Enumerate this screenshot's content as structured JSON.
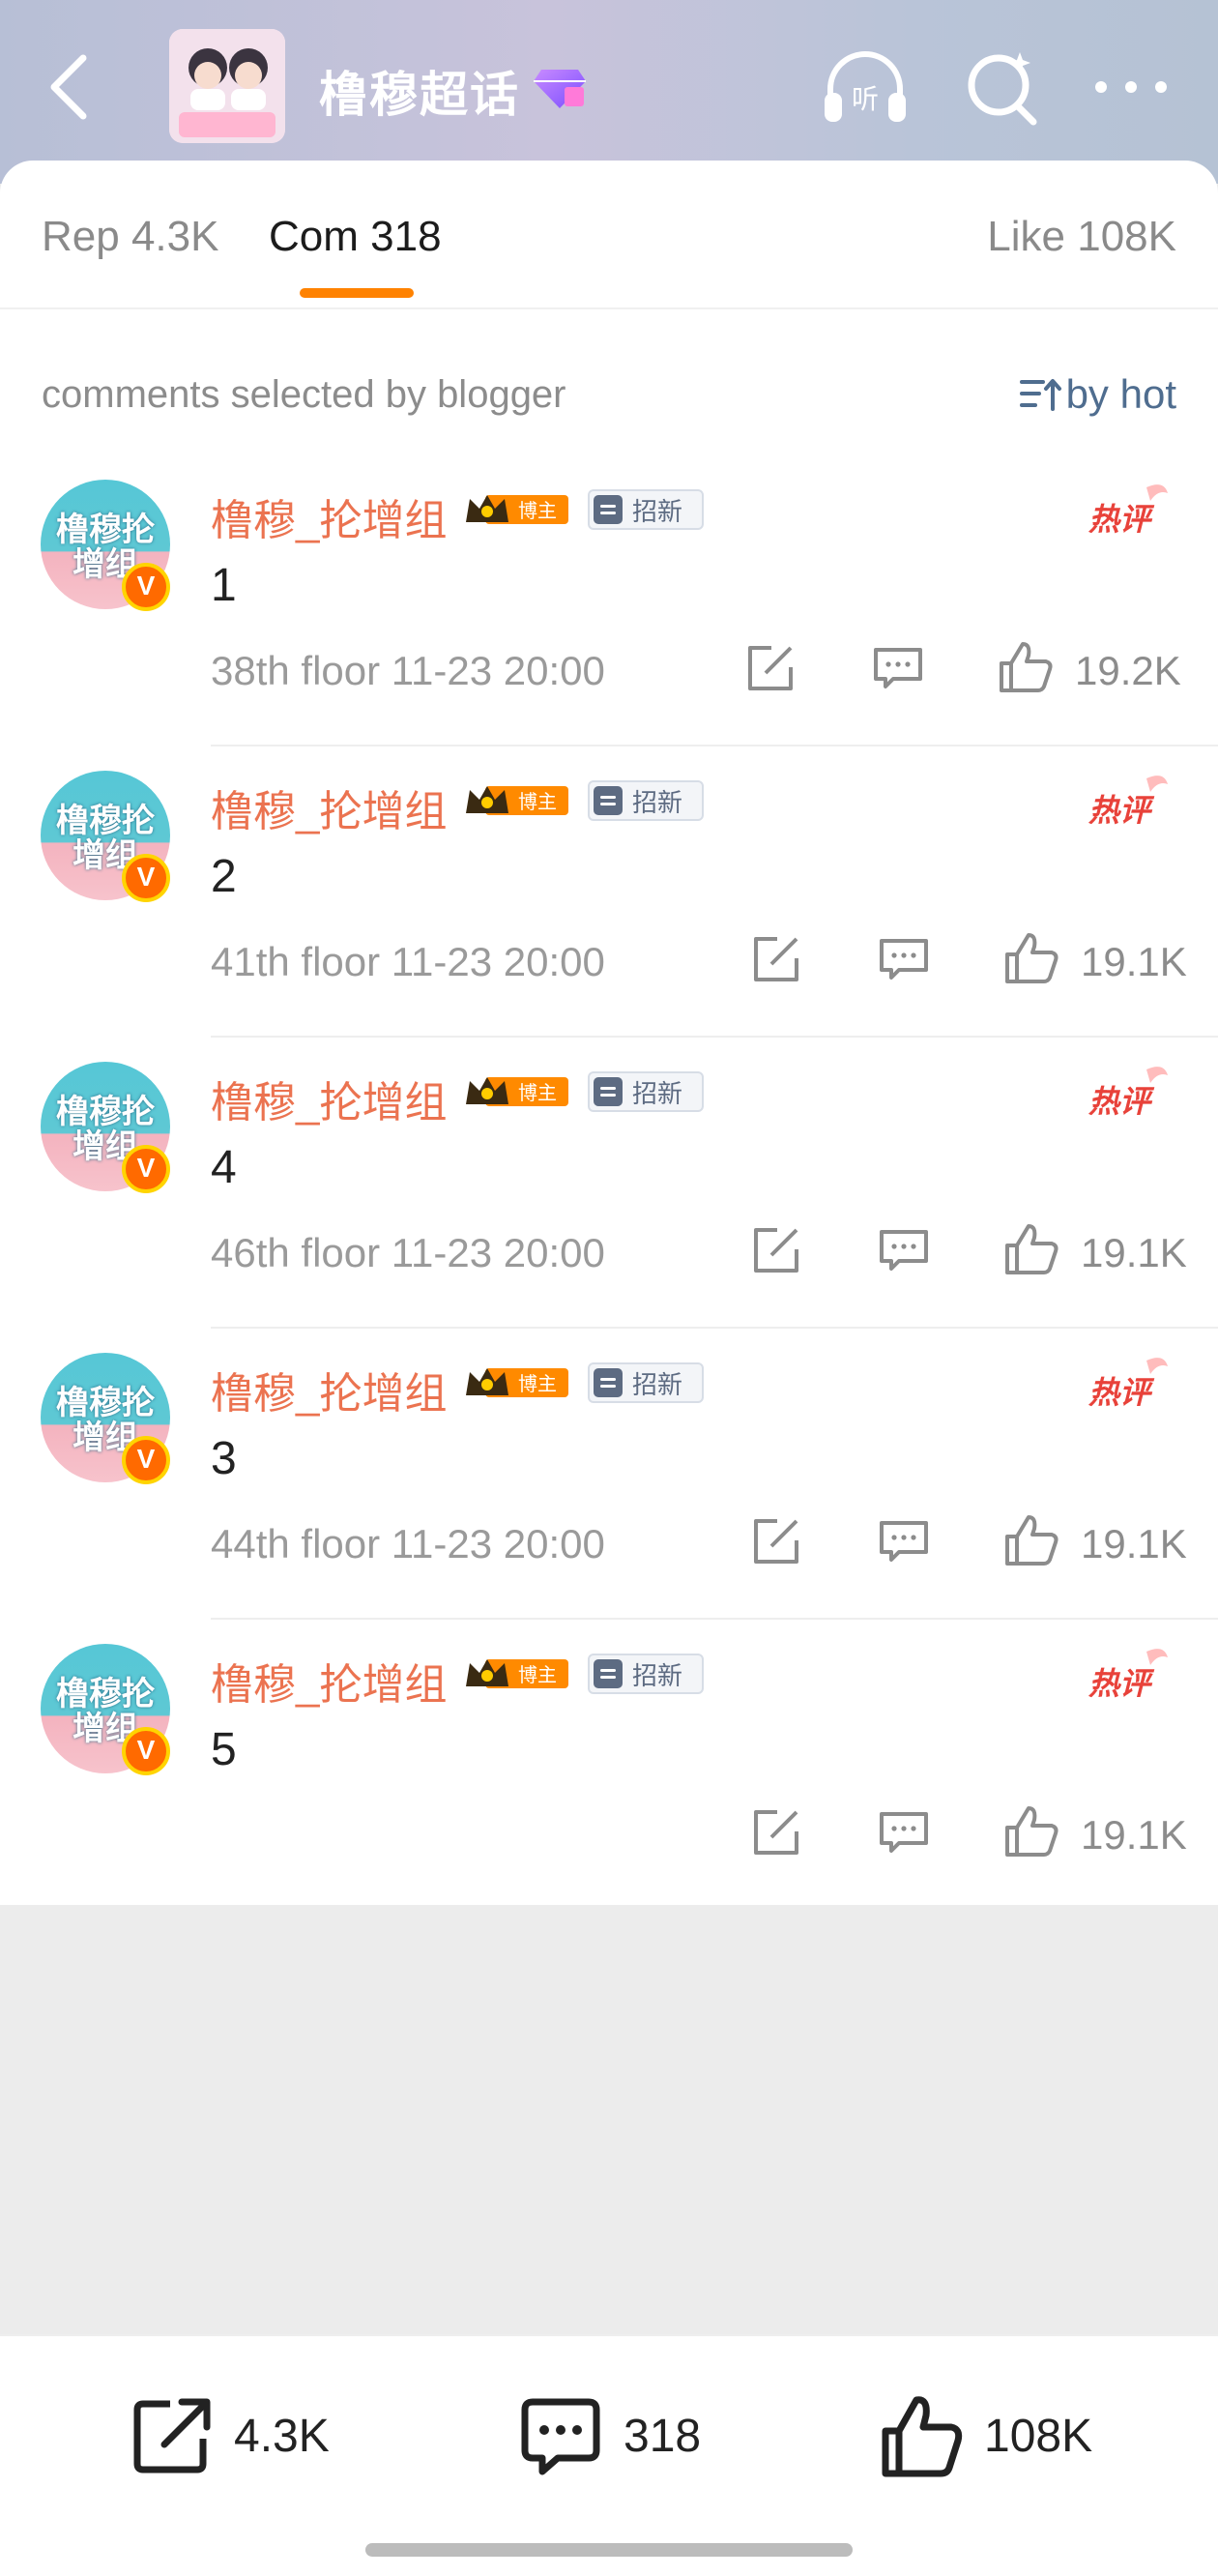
{
  "header": {
    "topic_title": "橹穆超话",
    "topic_avatar_caption": "橹穆超话"
  },
  "tabs": [
    {
      "label": "Rep 4.3K",
      "active": false
    },
    {
      "label": "Com 318",
      "active": true
    },
    {
      "label": "Like 108K",
      "active": false
    }
  ],
  "colors": {
    "accent": "#ff8200",
    "username": "#eb7350",
    "link_blue": "#4f6d8f"
  },
  "section": {
    "label": "comments selected by blogger",
    "sort_label": "by hot"
  },
  "comments": [
    {
      "username": "橹穆_抡增组",
      "crown_label": "博主",
      "recruit_label": "招新",
      "hot_label": "热评",
      "text": "1",
      "meta": "38th floor 11-23 20:00",
      "likes": "19.2K",
      "avatar_text": "橹穆抡增组"
    },
    {
      "username": "橹穆_抡增组",
      "crown_label": "博主",
      "recruit_label": "招新",
      "hot_label": "热评",
      "text": "2",
      "meta": "41th floor 11-23 20:00",
      "likes": "19.1K",
      "avatar_text": "橹穆抡增组"
    },
    {
      "username": "橹穆_抡增组",
      "crown_label": "博主",
      "recruit_label": "招新",
      "hot_label": "热评",
      "text": "4",
      "meta": "46th floor 11-23 20:00",
      "likes": "19.1K",
      "avatar_text": "橹穆抡增组"
    },
    {
      "username": "橹穆_抡增组",
      "crown_label": "博主",
      "recruit_label": "招新",
      "hot_label": "热评",
      "text": "3",
      "meta": "44th floor 11-23 20:00",
      "likes": "19.1K",
      "avatar_text": "橹穆抡增组"
    },
    {
      "username": "橹穆_抡增组",
      "crown_label": "博主",
      "recruit_label": "招新",
      "hot_label": "热评",
      "text": "5",
      "meta": "",
      "likes": "19.1K",
      "avatar_text": "橹穆抡增组"
    }
  ],
  "bottom_bar": {
    "reposts": "4.3K",
    "comments": "318",
    "likes": "108K"
  }
}
